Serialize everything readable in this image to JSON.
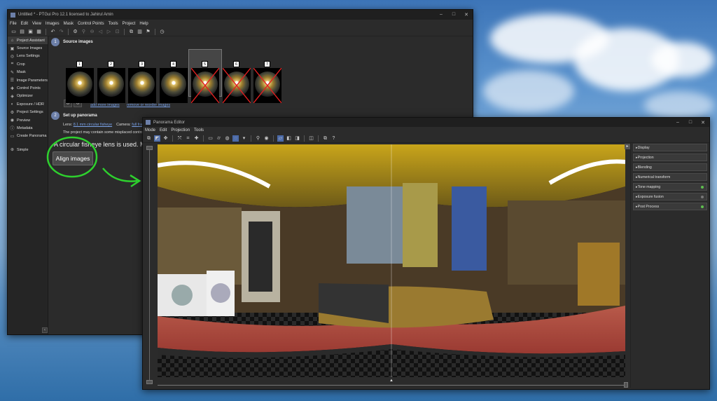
{
  "main_window": {
    "title": "Untitled * - PTGui Pro 12.1 licensed to Jahirul Amin",
    "menu": [
      "File",
      "Edit",
      "View",
      "Images",
      "Mask",
      "Control Points",
      "Tools",
      "Project",
      "Help"
    ],
    "sidebar": [
      {
        "label": "Project Assistant",
        "icon": "home-icon"
      },
      {
        "label": "Source Images",
        "icon": "image-icon"
      },
      {
        "label": "Lens Settings",
        "icon": "lens-icon"
      },
      {
        "label": "Crop",
        "icon": "crop-icon"
      },
      {
        "label": "Mask",
        "icon": "brush-icon"
      },
      {
        "label": "Image Parameters",
        "icon": "sliders-icon"
      },
      {
        "label": "Control Points",
        "icon": "control-points-icon"
      },
      {
        "label": "Optimizer",
        "icon": "optimizer-icon"
      },
      {
        "label": "Exposure / HDR",
        "icon": "exposure-icon"
      },
      {
        "label": "Project Settings",
        "icon": "gear-icon"
      },
      {
        "label": "Preview",
        "icon": "eye-icon"
      },
      {
        "label": "Metadata",
        "icon": "info-icon"
      },
      {
        "label": "Create Panorama",
        "icon": "panorama-icon"
      }
    ],
    "sidebar_simple": "Simple",
    "step1": {
      "num": "1",
      "title": "Source images"
    },
    "thumbnails": [
      "1",
      "2",
      "3",
      "4",
      "5",
      "6",
      "7"
    ],
    "add_more_images": "add more images",
    "remove_reorder": "remove or reorder images",
    "step2": {
      "num": "2",
      "title": "Set up panorama"
    },
    "lens_label": "Lens:",
    "lens_value": "8.1 mm circular fisheye",
    "camera_label": "Camera:",
    "camera_value": "full frame",
    "project_note": "The project may contain some misplaced control p",
    "fisheye_text": "A circular fisheye lens is used. Make s",
    "align_button": "Align images"
  },
  "editor_window": {
    "title": "Panorama Editor",
    "menu": [
      "Mode",
      "Edit",
      "Projection",
      "Tools"
    ],
    "right_panel": [
      {
        "label": "Display",
        "dot": ""
      },
      {
        "label": "Projection",
        "dot": ""
      },
      {
        "label": "Blending",
        "dot": ""
      },
      {
        "label": "Numerical transform",
        "dot": ""
      },
      {
        "label": "Tone mapping",
        "dot": "#5fbf4f"
      },
      {
        "label": "Exposure fusion",
        "dot": "#777777"
      },
      {
        "label": "Post Process",
        "dot": "#5fbf4f"
      }
    ]
  },
  "colors": {
    "annotation_green": "#2ed12e",
    "accent_blue": "#7aa2e8",
    "step_circle": "#6c7fa8",
    "x_red": "#e02020"
  }
}
